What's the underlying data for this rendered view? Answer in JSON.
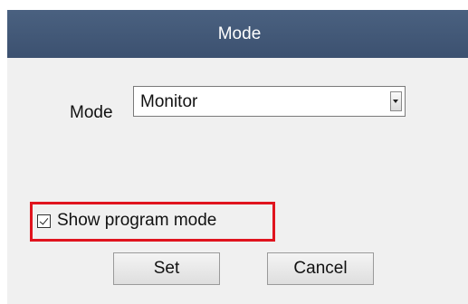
{
  "dialog": {
    "title": "Mode"
  },
  "mode": {
    "label": "Mode",
    "selected_value": "Monitor"
  },
  "show_program_mode": {
    "label": "Show program mode",
    "checked": true
  },
  "buttons": {
    "set_label": "Set",
    "cancel_label": "Cancel"
  },
  "colors": {
    "title_bar": "#3f5474",
    "highlight_border": "#e0141e",
    "dialog_background": "#f0f0f0"
  }
}
